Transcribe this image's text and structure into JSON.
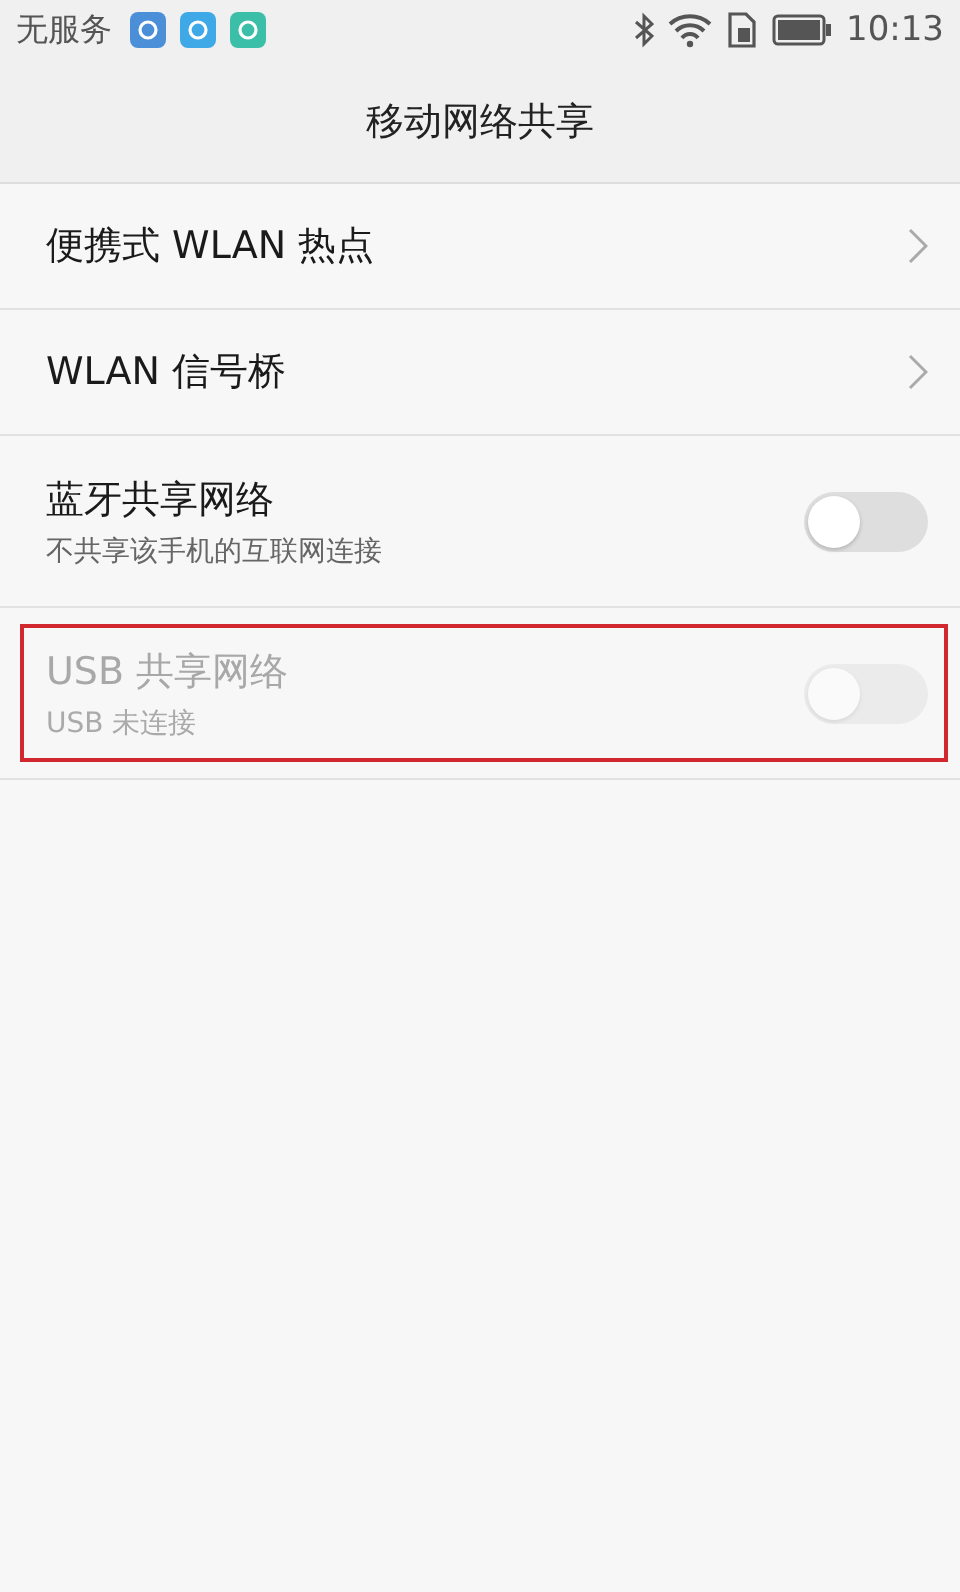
{
  "status_bar": {
    "carrier": "无服务",
    "time": "10:13",
    "notification_icons": [
      {
        "color": "#4a8fd8"
      },
      {
        "color": "#3fa9e8"
      },
      {
        "color": "#3bbfa8"
      }
    ]
  },
  "title": "移动网络共享",
  "rows": [
    {
      "kind": "link",
      "title": "便携式 WLAN 热点"
    },
    {
      "kind": "link",
      "title": "WLAN 信号桥"
    },
    {
      "kind": "toggle",
      "title": "蓝牙共享网络",
      "subtitle": "不共享该手机的互联网连接",
      "on": false,
      "disabled": false,
      "highlighted": false
    },
    {
      "kind": "toggle",
      "title": "USB 共享网络",
      "subtitle": "USB 未连接",
      "on": false,
      "disabled": true,
      "highlighted": true
    }
  ]
}
